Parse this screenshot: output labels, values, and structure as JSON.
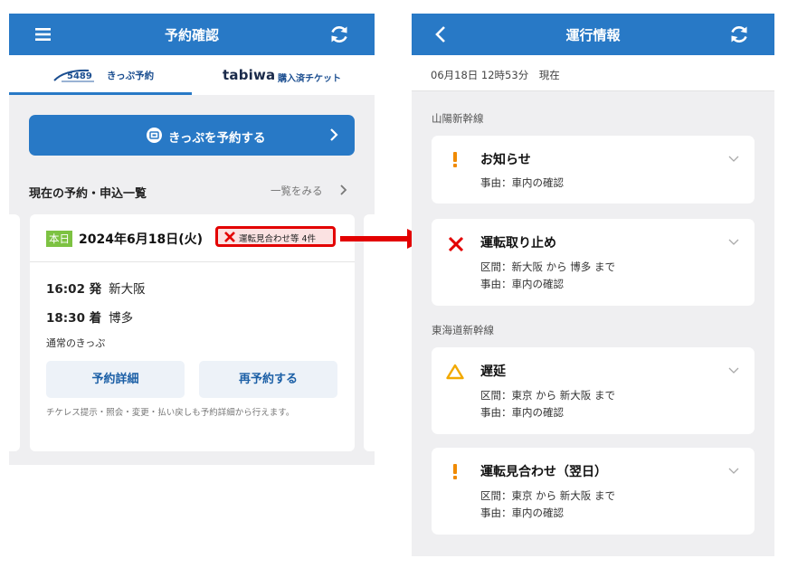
{
  "left_screen": {
    "header": {
      "title": "予約確認"
    },
    "tabs": [
      {
        "logo_text": "5489",
        "label": "きっぷ予約"
      },
      {
        "logo_text": "tabiwa",
        "label": "購入済チケット"
      }
    ],
    "book_button": {
      "label": "きっぷを予約する"
    },
    "section": {
      "title": "現在の予約・申込一覧",
      "see_more": "一覧をみる"
    },
    "reservation": {
      "today_badge": "本日",
      "date": "2024年6月18日(火)",
      "alert_label": "運転見合わせ等 4件",
      "departure": {
        "time": "16:02 発",
        "station": "新大阪"
      },
      "arrival": {
        "time": "18:30 着",
        "station": "博多"
      },
      "ticket_type": "通常のきっぷ",
      "detail_button": "予約詳細",
      "rebook_button": "再予約する",
      "note": "チケレス提示・照会・変更・払い戻しも予約詳細から行えます。"
    }
  },
  "right_screen": {
    "header": {
      "title": "運行情報"
    },
    "timestamp": "06月18日 12時53分　現在",
    "lines": [
      {
        "name": "山陽新幹線",
        "items": [
          {
            "icon": "exclamation-icon",
            "title": "お知らせ",
            "details": [
              "事由：車内の確認"
            ]
          },
          {
            "icon": "cross-icon",
            "title": "運転取り止め",
            "details": [
              "区間：新大阪 から 博多 まで",
              "事由：車内の確認"
            ]
          }
        ]
      },
      {
        "name": "東海道新幹線",
        "items": [
          {
            "icon": "warning-triangle-icon",
            "title": "遅延",
            "details": [
              "区間：東京 から 新大阪 まで",
              "事由：車内の確認"
            ]
          },
          {
            "icon": "exclamation-icon",
            "title": "運転見合わせ（翌日）",
            "details": [
              "区間：東京 から 新大阪 まで",
              "事由：車内の確認"
            ]
          }
        ]
      }
    ]
  },
  "colors": {
    "primary": "#2879c6",
    "alert_red": "#e30000",
    "notice_orange": "#f08a00",
    "delay_yellow": "#f2a900",
    "today_green": "#7dc242"
  }
}
